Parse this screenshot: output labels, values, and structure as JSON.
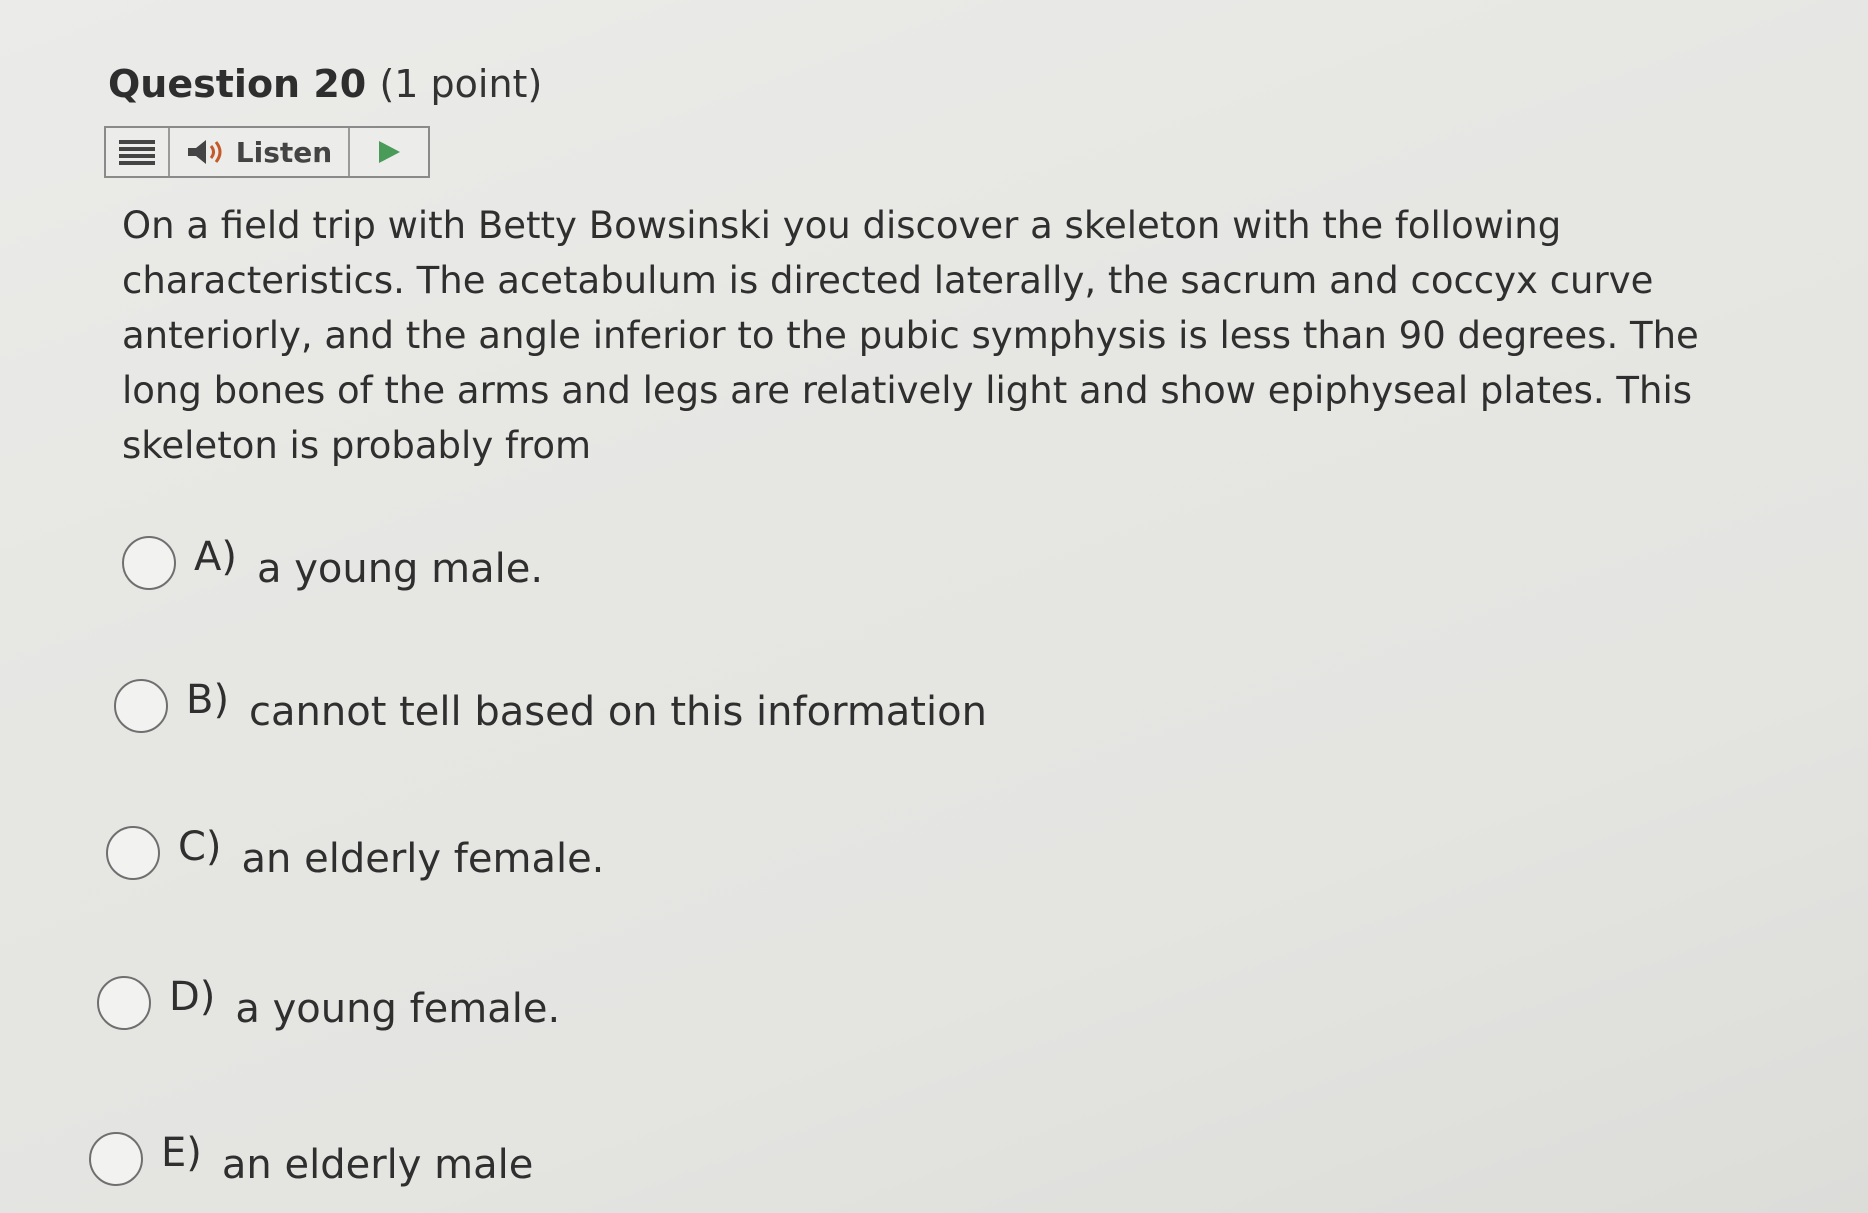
{
  "question": {
    "title": "Question 20",
    "points": "(1 point)",
    "text": "On a field trip with Betty Bowsinski you discover a skeleton with the following characteristics. The acetabulum is directed laterally, the sacrum and coccyx curve anteriorly, and the angle inferior to the pubic symphysis is less than 90 degrees. The long bones of the arms and legs are relatively light and show epiphyseal plates. This skeleton is probably from"
  },
  "toolbar": {
    "menu_icon": "menu-icon",
    "speaker_icon": "speaker-icon",
    "listen_label": "Listen",
    "play_icon": "play-icon",
    "accent_color": "#4a9a5a"
  },
  "options": [
    {
      "letter": "A)",
      "text": "a young male."
    },
    {
      "letter": "B)",
      "text": "cannot tell based on this information"
    },
    {
      "letter": "C)",
      "text": "an elderly female."
    },
    {
      "letter": "D)",
      "text": "a young female."
    },
    {
      "letter": "E)",
      "text": "an elderly male"
    }
  ]
}
